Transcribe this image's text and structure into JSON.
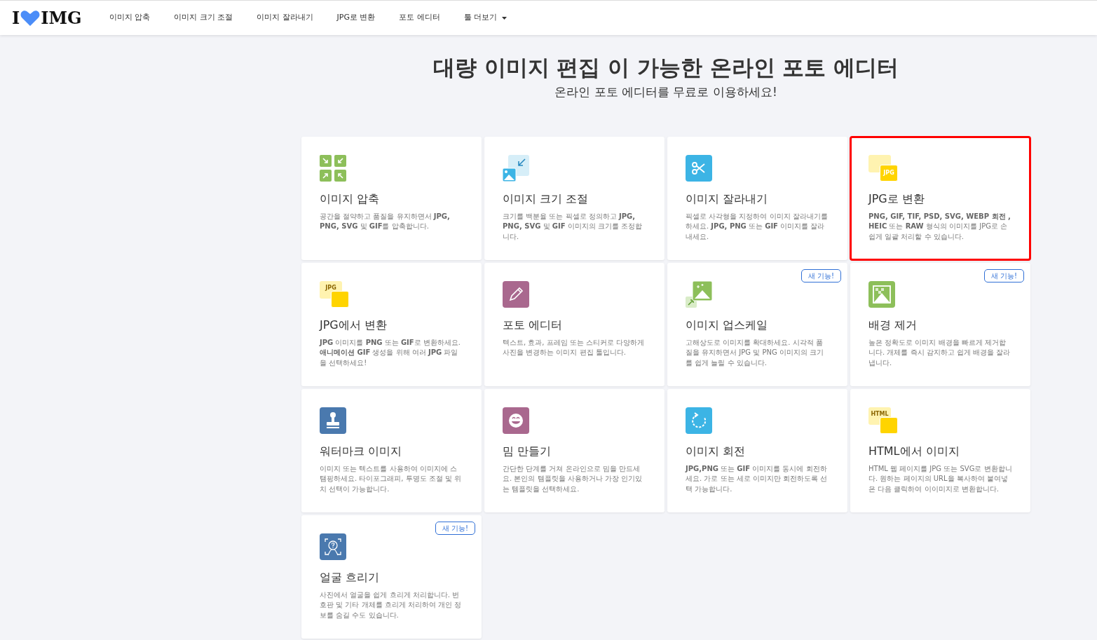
{
  "logo": {
    "left": "I",
    "right": "IMG"
  },
  "nav": [
    {
      "label": "이미지 압축",
      "dropdown": false
    },
    {
      "label": "이미지 크기 조절",
      "dropdown": false
    },
    {
      "label": "이미지 잘라내기",
      "dropdown": false
    },
    {
      "label": "JPG로 변환",
      "dropdown": false
    },
    {
      "label": "포토 에디터",
      "dropdown": false
    },
    {
      "label": "툴 더보기",
      "dropdown": true
    }
  ],
  "heading": {
    "title": "대량 이미지 편집 이 가능한 온라인 포토 에디터",
    "subtitle": "온라인 포토 에디터를 무료로 이용하세요!"
  },
  "tools": [
    {
      "kind": "compress",
      "title": "이미지 압축",
      "description": "공간을 절약하고 품질을 유지하면서 **JPG, PNG, SVG** 및 **GIF**를 압축합니다.",
      "highlighted": false
    },
    {
      "kind": "resize",
      "title": "이미지 크기 조절",
      "description": "크기를 백분율 또는 픽셀로 정의하고 **JPG, PNG, SVG** 및 **GIF** 이미지의 크기를 조정합니다.",
      "highlighted": false
    },
    {
      "kind": "crop",
      "title": "이미지 잘라내기",
      "description": "픽셀로 사각형을 지정하여 이미지 잘라내기를 하세요. **JPG, PNG** 또는 **GIF** 이미지를 잘라 내세요.",
      "highlighted": false
    },
    {
      "kind": "to-jpg",
      "icon_label": "JPG",
      "title": "JPG로 변환",
      "description": "**PNG, GIF, TIF, PSD, SVG, WEBP 회전 , HEIC** 또는 **RAW** 형식의 이미지를 JPG로 손쉽게 일괄 처리할 수 있습니다.",
      "highlighted": true
    },
    {
      "kind": "from-jpg",
      "icon_label": "JPG",
      "title": "JPG에서 변환",
      "description": "**JPG** 이미지를 **PNG** 또는 **GIF**로 변환하세요. **애니메이션 GIF** 생성을 위해 여러 **JPG** 파일을 선택하세요!",
      "highlighted": false
    },
    {
      "kind": "editor",
      "title": "포토 에디터",
      "description": "텍스트, 효과, 프레임 또는 스티커로 다양하게 사진을 변경하는 이미지 편집 툴입니다.",
      "highlighted": false
    },
    {
      "kind": "upscale",
      "badge": "새 기능!",
      "title": "이미지 업스케일",
      "description": "고해상도로 이미지를 확대하세요. 시각적 품질을 유지하면서 JPG 및 PNG 이미지의 크기를 쉽게 늘릴 수 있습니다.",
      "highlighted": false
    },
    {
      "kind": "remove-bg",
      "badge": "새 기능!",
      "title": "배경 제거",
      "description": "높은 정확도로 이미지 배경을 빠르게 제거합니다. 개체를 즉시 감지하고 쉽게 배경을 잘라냅니다.",
      "highlighted": false
    },
    {
      "kind": "watermark",
      "title": "워터마크 이미지",
      "description": "이미지 또는 텍스트를 사용하여 이미지에 스탬핑하세요. 타이포그래피, 투명도 조절 및 위치 선택이 가능합니다.",
      "highlighted": false
    },
    {
      "kind": "meme",
      "title": "밈 만들기",
      "description": "간단한 단계를 거쳐 온라인으로 밈을 만드세요. 본인의 템플릿을 사용하거나 가장 인기있는 템플릿을 선택하세요.",
      "highlighted": false
    },
    {
      "kind": "rotate",
      "title": "이미지 회전",
      "description": "**JPG,PNG** 또는 **GIF** 이미지를 동시에 회전하세요. 가로 또는 세로 이미지만 회전하도록 선택 가능합니다.",
      "highlighted": false
    },
    {
      "kind": "html",
      "icon_label": "HTML",
      "title": "HTML에서 이미지",
      "description": "HTML 웹 페이지를 JPG 또는 SVG로 변환합니다. 원하는 페이지의 URL을 복사하여 붙여넣은 다음 클릭하여 이이미지로 변환합니다.",
      "highlighted": false
    },
    {
      "kind": "blur",
      "badge": "새 기능!",
      "title": "얼굴 흐리기",
      "description": "사진에서 얼굴을 쉽게 흐리게 처리합니다. 번호판 및 기타 개체를 흐리게 처리하여 개인 정보를 숨길 수도 있습니다.",
      "highlighted": false
    }
  ]
}
